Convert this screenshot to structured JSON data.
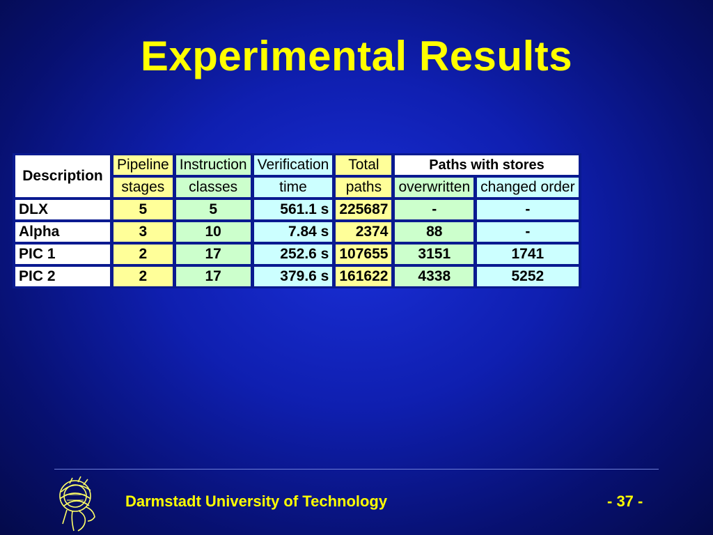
{
  "title": "Experimental Results",
  "table": {
    "header_description": "Description",
    "header_group": "Paths with stores",
    "columns": [
      {
        "line1": "Pipeline",
        "line2": "stages"
      },
      {
        "line1": "Instruction",
        "line2": "classes"
      },
      {
        "line1": "Verification",
        "line2": "time"
      },
      {
        "line1": "Total",
        "line2": "paths"
      }
    ],
    "subcolumns": [
      "overwritten",
      "changed order"
    ],
    "rows": [
      {
        "desc": "DLX",
        "pipeline": "5",
        "instr": "5",
        "time": "561.1 s",
        "total": "225687",
        "overwritten": "-",
        "changed": "-"
      },
      {
        "desc": "Alpha",
        "pipeline": "3",
        "instr": "10",
        "time": "7.84 s",
        "total": "2374",
        "overwritten": "88",
        "changed": "-"
      },
      {
        "desc": "PIC 1",
        "pipeline": "2",
        "instr": "17",
        "time": "252.6 s",
        "total": "107655",
        "overwritten": "3151",
        "changed": "1741"
      },
      {
        "desc": "PIC 2",
        "pipeline": "2",
        "instr": "17",
        "time": "379.6 s",
        "total": "161622",
        "overwritten": "4338",
        "changed": "5252"
      }
    ]
  },
  "footer": {
    "institution": "Darmstadt University of Technology",
    "page": "- 37 -"
  },
  "colors": {
    "title": "#ffff00",
    "background": "#0f1fb0",
    "yellow_cell": "#ffff99",
    "green_cell": "#ccffcc",
    "cyan_cell": "#ccffff"
  },
  "icons": {
    "logo": "athena-head-logo"
  }
}
